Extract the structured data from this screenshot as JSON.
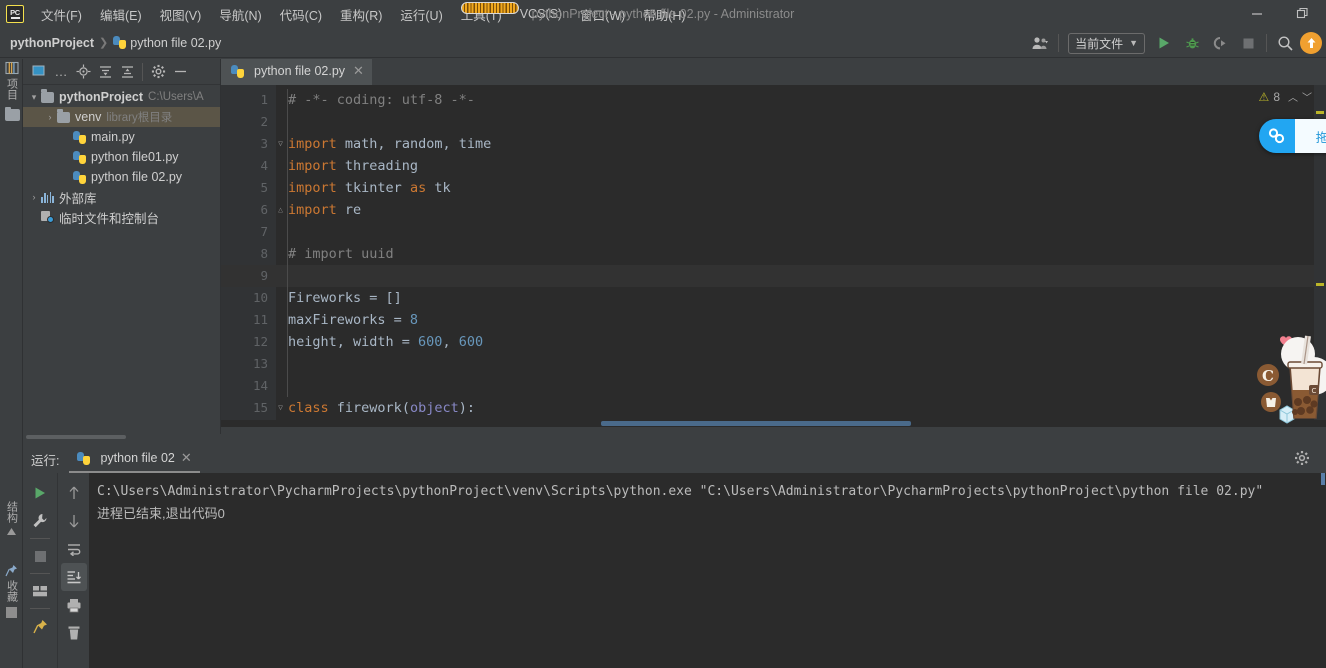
{
  "window": {
    "app_icon": "pycharm-logo-icon",
    "title": "pythonProject - python file 02.py - Administrator",
    "minimize": "−",
    "maximize": "❐"
  },
  "menubar": {
    "items": [
      {
        "label": "文件(F)",
        "name": "menu-file"
      },
      {
        "label": "编辑(E)",
        "name": "menu-edit"
      },
      {
        "label": "视图(V)",
        "name": "menu-view"
      },
      {
        "label": "导航(N)",
        "name": "menu-navigate"
      },
      {
        "label": "代码(C)",
        "name": "menu-code"
      },
      {
        "label": "重构(R)",
        "name": "menu-refactor"
      },
      {
        "label": "运行(U)",
        "name": "menu-run"
      },
      {
        "label": "工具(T)",
        "name": "menu-tools"
      },
      {
        "label": "VCS(S)",
        "name": "menu-vcs"
      },
      {
        "label": "窗口(W)",
        "name": "menu-window"
      },
      {
        "label": "帮助(H)",
        "name": "menu-help"
      }
    ]
  },
  "navbar": {
    "breadcrumb_project": "pythonProject",
    "breadcrumb_sep": "❯",
    "breadcrumb_file": "python file 02.py",
    "run_config": "当前文件",
    "run_config_caret": "▼",
    "icons": {
      "user": "user-avatar-icon",
      "run": "run-icon",
      "debug": "debug-icon",
      "coverage": "run-with-coverage-icon",
      "stop": "stop-icon",
      "search": "search-icon",
      "update": "update-project-icon"
    }
  },
  "left_stripe": {
    "project_tab": "项目",
    "structure_tab": "结构",
    "favorites_tab": "收藏"
  },
  "project_panel": {
    "toolbar_icons": [
      "select-opened-file-icon",
      "more-icon",
      "locate-icon",
      "expand-all-icon",
      "collapse-all-icon",
      "settings-icon",
      "hide-icon"
    ],
    "tree": [
      {
        "label": "pythonProject",
        "hint": "C:\\Users\\A",
        "depth": 0,
        "icon": "folder-icon",
        "arrow": "▾",
        "bold": true,
        "selected": false,
        "name": "tree-node-pythonproject"
      },
      {
        "label": "venv",
        "hint": "library根目录",
        "depth": 1,
        "icon": "folder-icon",
        "arrow": "›",
        "bold": false,
        "selected": true,
        "name": "tree-node-venv"
      },
      {
        "label": "main.py",
        "hint": "",
        "depth": 2,
        "icon": "python-file-icon",
        "arrow": "",
        "bold": false,
        "selected": false,
        "name": "tree-node-main-py"
      },
      {
        "label": "python file01.py",
        "hint": "",
        "depth": 2,
        "icon": "python-file-icon",
        "arrow": "",
        "bold": false,
        "selected": false,
        "name": "tree-node-python-file01-py"
      },
      {
        "label": "python file 02.py",
        "hint": "",
        "depth": 2,
        "icon": "python-file-icon",
        "arrow": "",
        "bold": false,
        "selected": false,
        "name": "tree-node-python-file-02-py"
      },
      {
        "label": "外部库",
        "hint": "",
        "depth": 0,
        "icon": "library-icon",
        "arrow": "›",
        "bold": false,
        "selected": false,
        "name": "tree-node-external-libraries"
      },
      {
        "label": "临时文件和控制台",
        "hint": "",
        "depth": 0,
        "icon": "scratches-icon",
        "arrow": "",
        "bold": false,
        "selected": false,
        "name": "tree-node-scratches-consoles"
      }
    ]
  },
  "editor": {
    "tab_label": "python file 02.py",
    "tab_close": "✕",
    "inspection_count": "8",
    "inspection_up": "︿",
    "inspection_down": "﹀",
    "lines": [
      {
        "n": "1",
        "fold": "",
        "current": false,
        "tokens": [
          {
            "t": "# -*- coding: utf-8 -*-",
            "c": "cm"
          }
        ]
      },
      {
        "n": "2",
        "fold": "",
        "current": false,
        "tokens": []
      },
      {
        "n": "3",
        "fold": "▽",
        "current": false,
        "tokens": [
          {
            "t": "import ",
            "c": "k"
          },
          {
            "t": "math",
            "c": "ident"
          },
          {
            "t": ", ",
            "c": "ident"
          },
          {
            "t": "random",
            "c": "ident"
          },
          {
            "t": ", ",
            "c": "ident"
          },
          {
            "t": "time",
            "c": "ident"
          }
        ]
      },
      {
        "n": "4",
        "fold": "",
        "current": false,
        "tokens": [
          {
            "t": "import ",
            "c": "k"
          },
          {
            "t": "threading",
            "c": "ident"
          }
        ]
      },
      {
        "n": "5",
        "fold": "",
        "current": false,
        "tokens": [
          {
            "t": "import ",
            "c": "k"
          },
          {
            "t": "tkinter ",
            "c": "ident"
          },
          {
            "t": "as ",
            "c": "k"
          },
          {
            "t": "tk",
            "c": "ident"
          }
        ]
      },
      {
        "n": "6",
        "fold": "△",
        "current": false,
        "tokens": [
          {
            "t": "import ",
            "c": "k"
          },
          {
            "t": "re",
            "c": "ident"
          }
        ]
      },
      {
        "n": "7",
        "fold": "",
        "current": false,
        "tokens": []
      },
      {
        "n": "8",
        "fold": "",
        "current": false,
        "tokens": [
          {
            "t": "# import uuid",
            "c": "cm"
          }
        ]
      },
      {
        "n": "9",
        "fold": "",
        "current": true,
        "tokens": []
      },
      {
        "n": "10",
        "fold": "",
        "current": false,
        "tokens": [
          {
            "t": "Fireworks = []",
            "c": "ident"
          }
        ]
      },
      {
        "n": "11",
        "fold": "",
        "current": false,
        "tokens": [
          {
            "t": "maxFireworks = ",
            "c": "ident"
          },
          {
            "t": "8",
            "c": "num"
          }
        ]
      },
      {
        "n": "12",
        "fold": "",
        "current": false,
        "tokens": [
          {
            "t": "height, width = ",
            "c": "ident"
          },
          {
            "t": "600",
            "c": "num"
          },
          {
            "t": ", ",
            "c": "ident"
          },
          {
            "t": "600",
            "c": "num"
          }
        ]
      },
      {
        "n": "13",
        "fold": "",
        "current": false,
        "tokens": []
      },
      {
        "n": "14",
        "fold": "",
        "current": false,
        "tokens": []
      },
      {
        "n": "15",
        "fold": "▽",
        "current": false,
        "tokens": [
          {
            "t": "class ",
            "c": "k"
          },
          {
            "t": "firework",
            "c": "ident"
          },
          {
            "t": "(",
            "c": "ident"
          },
          {
            "t": "object",
            "c": "obj"
          },
          {
            "t": "):",
            "c": "ident"
          }
        ]
      }
    ]
  },
  "float_widget": {
    "icon": "baidu-netdisk-icon",
    "label": "拖"
  },
  "sticker": {
    "name": "bubble-tea-sticker",
    "badge_c": "C",
    "badge_logo": "coco-logo"
  },
  "run_panel": {
    "header_label": "运行:",
    "tab_label": "python file 02",
    "tab_close": "✕",
    "gear": "settings-icon",
    "sidebar_left": [
      "rerun-icon",
      "wrench-icon",
      "stop-icon",
      "layout-icon",
      "pin-icon"
    ],
    "sidebar_right": [
      "up-arrow-icon",
      "down-arrow-icon",
      "soft-wrap-icon",
      "scroll-to-end-icon",
      "print-icon",
      "trash-icon"
    ],
    "console_lines": [
      {
        "text": "C:\\Users\\Administrator\\PycharmProjects\\pythonProject\\venv\\Scripts\\python.exe \"C:\\Users\\Administrator\\PycharmProjects\\pythonProject\\python file 02.py\"",
        "zh": false
      },
      {
        "text": "",
        "zh": false
      },
      {
        "text": "进程已结束,退出代码0",
        "zh": true
      }
    ]
  },
  "colors": {
    "bg_chrome": "#3c3f41",
    "bg_editor": "#2b2b2b",
    "accent_orange": "#cc7832",
    "accent_number": "#6897bb",
    "selection": "#5b5547",
    "warning": "#bbb529",
    "run_green": "#5a9c46",
    "widget_blue": "#22a6f2"
  }
}
